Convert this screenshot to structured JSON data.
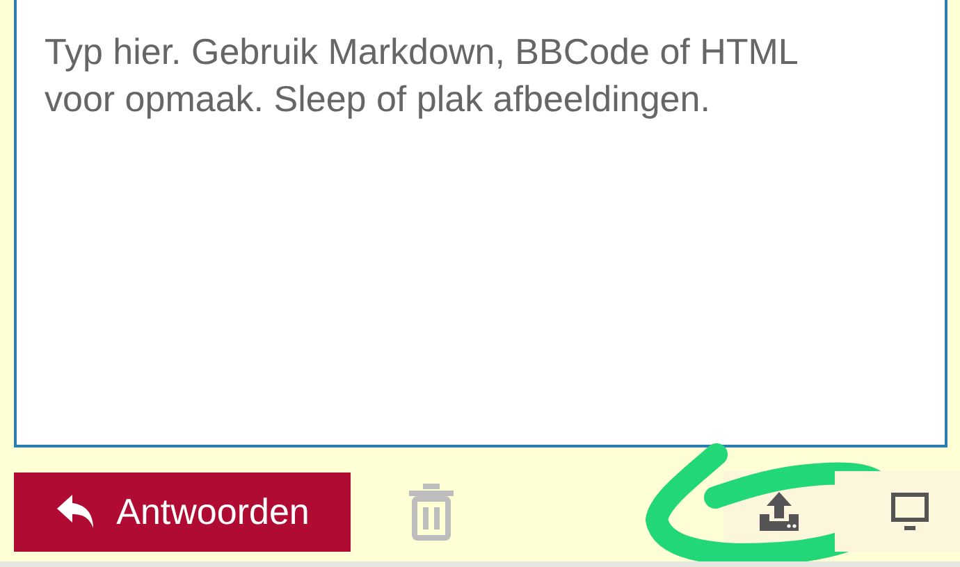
{
  "editor": {
    "placeholder": "Typ hier. Gebruik Markdown, BBCode of HTML voor opmaak. Sleep of plak afbeeldingen."
  },
  "reply_button": {
    "label": "Antwoorden"
  },
  "tools": [
    {
      "kind": "upload",
      "highlighted": true
    },
    {
      "kind": "preview",
      "highlighted": false
    }
  ]
}
